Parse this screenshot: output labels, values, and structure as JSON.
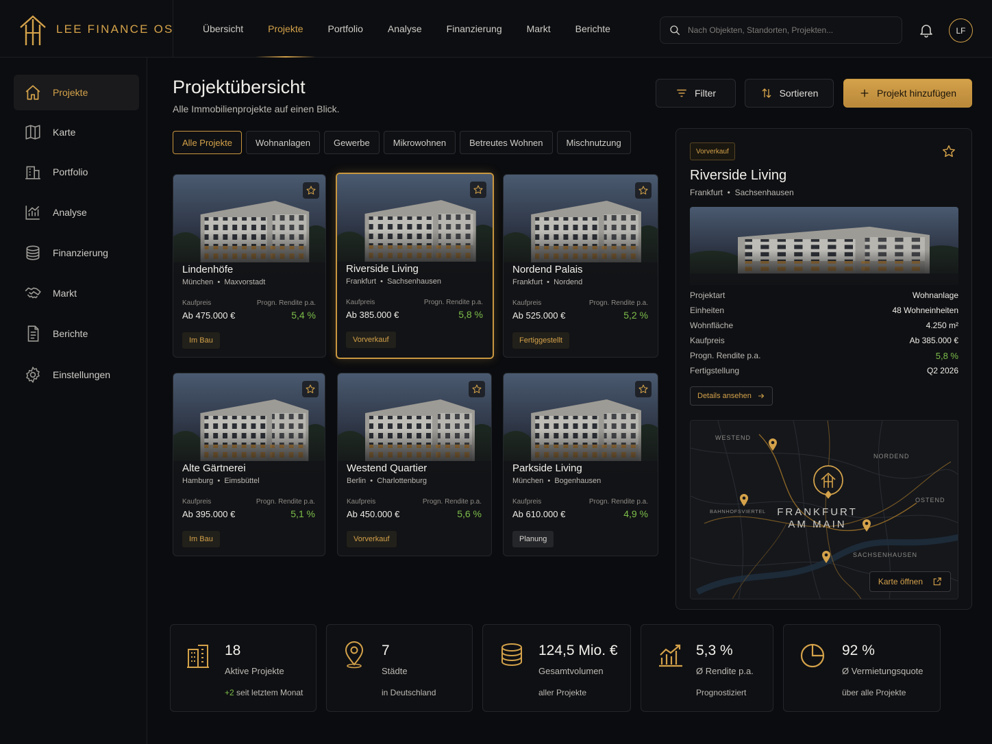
{
  "brand": {
    "name": "LEE FINANCE OS"
  },
  "topnav": [
    {
      "label": "Übersicht",
      "active": false
    },
    {
      "label": "Projekte",
      "active": true
    },
    {
      "label": "Portfolio",
      "active": false
    },
    {
      "label": "Analyse",
      "active": false
    },
    {
      "label": "Finanzierung",
      "active": false
    },
    {
      "label": "Markt",
      "active": false
    },
    {
      "label": "Berichte",
      "active": false
    }
  ],
  "search": {
    "placeholder": "Nach Objekten, Standorten, Projekten..."
  },
  "user": {
    "initials": "LF"
  },
  "sidebar": [
    {
      "label": "Projekte",
      "icon": "home-icon",
      "active": true
    },
    {
      "label": "Karte",
      "icon": "map-icon"
    },
    {
      "label": "Portfolio",
      "icon": "building-icon"
    },
    {
      "label": "Analyse",
      "icon": "chart-icon"
    },
    {
      "label": "Finanzierung",
      "icon": "coins-icon"
    },
    {
      "label": "Markt",
      "icon": "handshake-icon"
    },
    {
      "label": "Berichte",
      "icon": "report-icon"
    },
    {
      "label": "Einstellungen",
      "icon": "gear-icon"
    }
  ],
  "page": {
    "title": "Projektübersicht",
    "subtitle": "Alle Immobilienprojekte auf einen Blick."
  },
  "actions": {
    "filter": "Filter",
    "sort": "Sortieren",
    "add": "Projekt hinzufügen"
  },
  "chips": [
    "Alle Projekte",
    "Wohnanlagen",
    "Gewerbe",
    "Mikrowohnen",
    "Betreutes Wohnen",
    "Mischnutzung"
  ],
  "card_labels": {
    "price": "Kaufpreis",
    "yield": "Progn. Rendite p.a."
  },
  "projects": [
    {
      "name": "Lindenhöfe",
      "city": "München",
      "district": "Maxvorstadt",
      "price": "Ab 475.000 €",
      "yield": "5,4 %",
      "status": "Im Bau"
    },
    {
      "name": "Riverside Living",
      "city": "Frankfurt",
      "district": "Sachsenhausen",
      "price": "Ab 385.000 €",
      "yield": "5,8 %",
      "status": "Vorverkauf",
      "selected": true
    },
    {
      "name": "Nordend Palais",
      "city": "Frankfurt",
      "district": "Nordend",
      "price": "Ab 525.000 €",
      "yield": "5,2 %",
      "status": "Fertiggestellt"
    },
    {
      "name": "Alte Gärtnerei",
      "city": "Hamburg",
      "district": "Eimsbüttel",
      "price": "Ab 395.000 €",
      "yield": "5,1 %",
      "status": "Im Bau"
    },
    {
      "name": "Westend Quartier",
      "city": "Berlin",
      "district": "Charlottenburg",
      "price": "Ab 450.000 €",
      "yield": "5,6 %",
      "status": "Vorverkauf"
    },
    {
      "name": "Parkside Living",
      "city": "München",
      "district": "Bogenhausen",
      "price": "Ab 610.000 €",
      "yield": "4,9 %",
      "status": "Planung"
    }
  ],
  "detail": {
    "badge": "Vorverkauf",
    "name": "Riverside Living",
    "city": "Frankfurt",
    "district": "Sachsenhausen",
    "rows": [
      {
        "k": "Projektart",
        "v": "Wohnanlage"
      },
      {
        "k": "Einheiten",
        "v": "48 Wohneinheiten"
      },
      {
        "k": "Wohnfläche",
        "v": "4.250 m²"
      },
      {
        "k": "Kaufpreis",
        "v": "Ab 385.000 €"
      },
      {
        "k": "Progn. Rendite p.a.",
        "v": "5,8 %"
      },
      {
        "k": "Fertigstellung",
        "v": "Q2 2026"
      }
    ],
    "details_button": "Details ansehen",
    "map": {
      "city_line1": "FRANKFURT",
      "city_line2": "AM MAIN",
      "districts": [
        "WESTEND",
        "NORDEND",
        "OSTEND",
        "BAHNHOFSVIERTEL",
        "SACHSENHAUSEN"
      ],
      "open_button": "Karte öffnen"
    }
  },
  "stats": [
    {
      "value": "18",
      "label": "Aktive Projekte",
      "sub_plus": "+2",
      "sub": " seit letztem Monat",
      "icon": "buildings-icon"
    },
    {
      "value": "7",
      "label": "Städte",
      "sub": "in Deutschland",
      "icon": "location-pin-icon"
    },
    {
      "value": "124,5 Mio. €",
      "label": "Gesamtvolumen",
      "sub": "aller Projekte",
      "icon": "coins-stack-icon"
    },
    {
      "value": "5,3 %",
      "label": "Ø Rendite p.a.",
      "sub": "Prognostiziert",
      "icon": "growth-chart-icon"
    },
    {
      "value": "92 %",
      "label": "Ø Vermietungsquote",
      "sub": "über alle Projekte",
      "icon": "pie-chart-icon"
    }
  ],
  "colors": {
    "accent": "#d4a24a",
    "positive": "#7dbf4a",
    "background": "#0b0c0f"
  }
}
